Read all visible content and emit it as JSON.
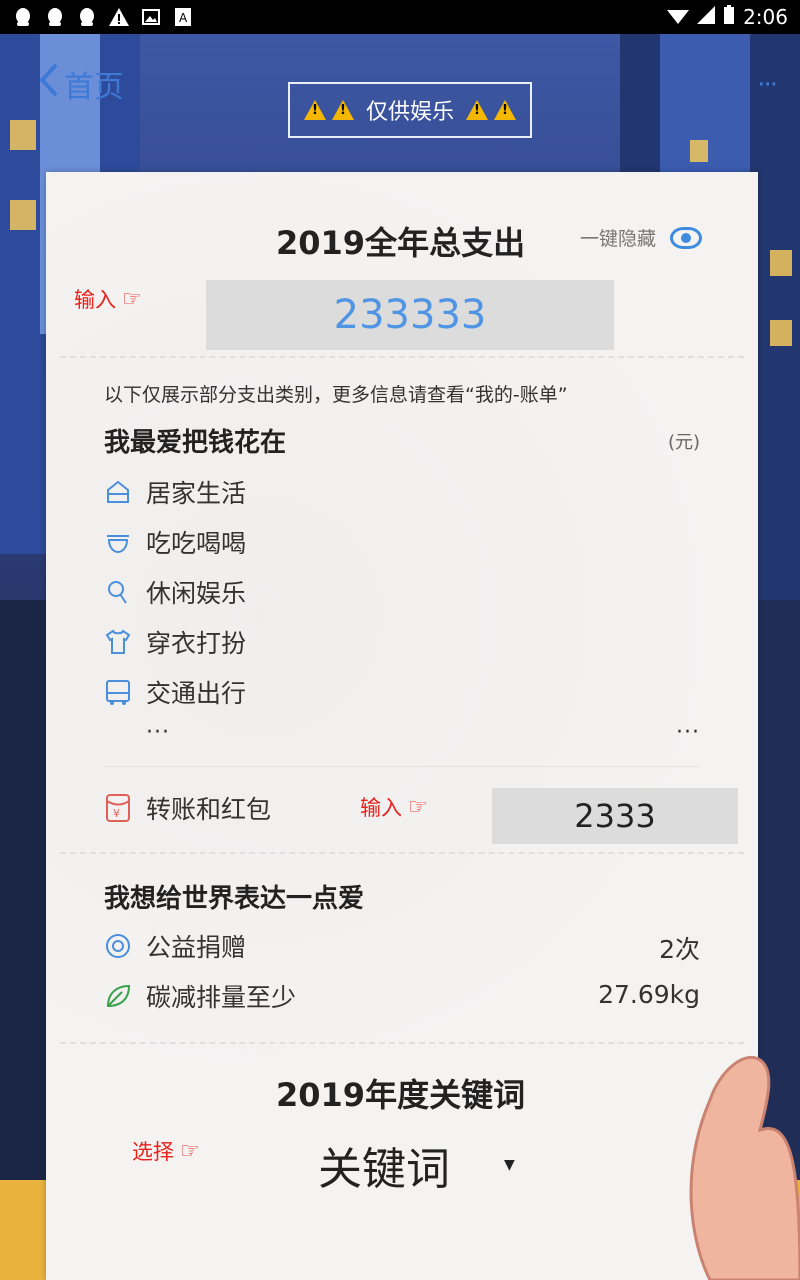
{
  "status_bar": {
    "time": "2:06",
    "icons": [
      "qq-icon",
      "qq-icon",
      "qq-icon",
      "warning-icon",
      "image-icon",
      "text-icon"
    ]
  },
  "nav": {
    "back_label": "首页",
    "more_label": "···"
  },
  "badge": {
    "label": "仅供娱乐"
  },
  "header": {
    "title": "2019全年总支出",
    "hide_label": "一键隐藏"
  },
  "total_input": {
    "hint": "输入",
    "value": "233333"
  },
  "categories": {
    "note": "以下仅展示部分支出类别，更多信息请查看“我的-账单”",
    "heading": "我最爱把钱花在",
    "unit": "(元)",
    "items": [
      {
        "label": "居家生活",
        "icon": "home-icon"
      },
      {
        "label": "吃吃喝喝",
        "icon": "bowl-icon"
      },
      {
        "label": "休闲娱乐",
        "icon": "leisure-icon"
      },
      {
        "label": "穿衣打扮",
        "icon": "shirt-icon"
      },
      {
        "label": "交通出行",
        "icon": "bus-icon"
      }
    ],
    "ellipsis_left": "···",
    "ellipsis_right": "···"
  },
  "transfer": {
    "label": "转账和红包",
    "hint": "输入",
    "value": "2333"
  },
  "love": {
    "heading": "我想给世界表达一点爱",
    "items": [
      {
        "label": "公益捐赠",
        "value": "2次",
        "icon": "charity-icon"
      },
      {
        "label": "碳减排量至少",
        "value": "27.69kg",
        "icon": "leaf-icon"
      }
    ]
  },
  "keyword": {
    "title": "2019年度关键词",
    "hint": "选择",
    "selected": "关键词"
  },
  "colors": {
    "accent_blue": "#3e79d6",
    "total_blue": "#4f95e3",
    "hint_red": "#e8221d",
    "paper": "#f5f3f2"
  }
}
